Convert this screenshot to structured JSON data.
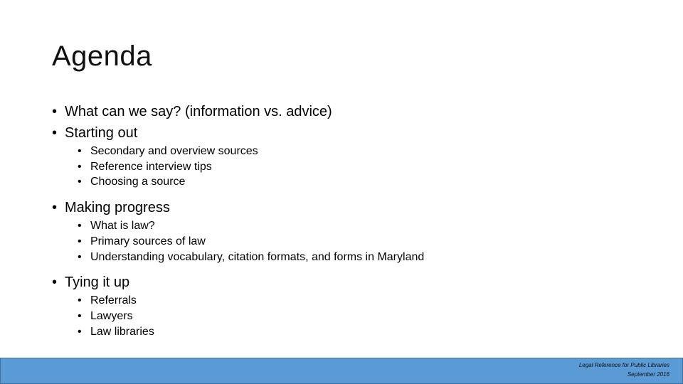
{
  "slide": {
    "title": "Agenda",
    "bullet_glyph": "•",
    "items": [
      {
        "label": "What can we say? (information vs. advice)",
        "subitems": []
      },
      {
        "label": "Starting out",
        "subitems": [
          "Secondary and overview sources",
          "Reference interview tips",
          "Choosing a source"
        ]
      },
      {
        "label": "Making progress",
        "subitems": [
          "What is law?",
          "Primary sources of law",
          "Understanding vocabulary, citation formats, and forms in Maryland"
        ]
      },
      {
        "label": "Tying it up",
        "subitems": [
          "Referrals",
          "Lawyers",
          "Law libraries"
        ]
      }
    ]
  },
  "footer": {
    "line1": "Legal Reference for Public Libraries",
    "line2": "September 2016",
    "color": "#5B9BD5",
    "border_color": "#41719C"
  }
}
